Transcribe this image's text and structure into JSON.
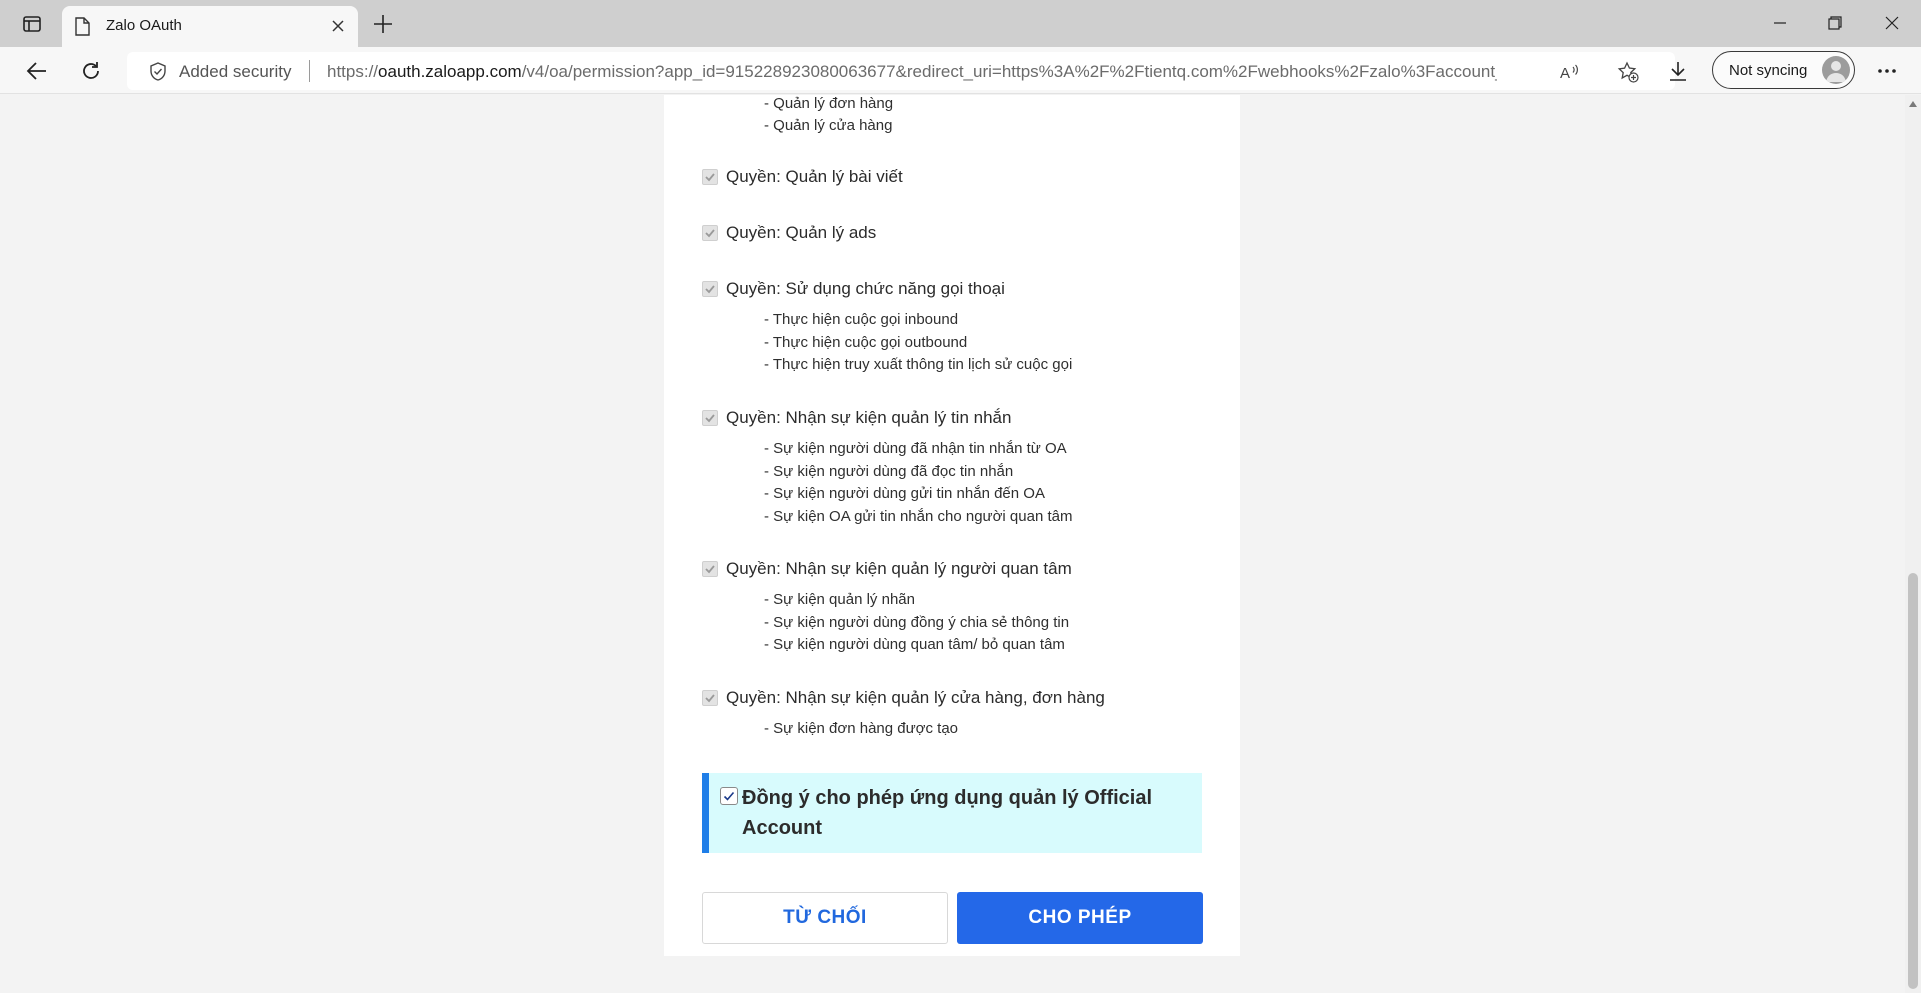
{
  "browser": {
    "tab_title": "Zalo OAuth",
    "security_label": "Added security",
    "url_prefix": "https://",
    "url_host": "oauth.zaloapp.com",
    "url_rest": "/v4/oa/permission?app_id=915228923080063677&redirect_uri=https%3A%2F%2Ftientq.com%2Fwebhooks%2Fzalo%3Faccount_i...",
    "sync_label": "Not syncing"
  },
  "permissions": {
    "top_partial": [
      "- Quản lý đơn hàng",
      "- Quản lý cửa hàng"
    ],
    "groups": [
      {
        "title": "Quyền: Quản lý bài viết",
        "items": []
      },
      {
        "title": "Quyền: Quản lý ads",
        "items": []
      },
      {
        "title": "Quyền: Sử dụng chức năng gọi thoại",
        "items": [
          "- Thực hiện cuộc gọi inbound",
          "- Thực hiện cuộc gọi outbound",
          "- Thực hiện truy xuất thông tin lịch sử cuộc gọi"
        ]
      },
      {
        "title": "Quyền: Nhận sự kiện quản lý tin nhắn",
        "items": [
          "- Sự kiện người dùng đã nhận tin nhắn từ OA",
          "- Sự kiện người dùng đã đọc tin nhắn",
          "- Sự kiện người dùng gửi tin nhắn đến OA",
          "- Sự kiện OA gửi tin nhắn cho người quan tâm"
        ]
      },
      {
        "title": "Quyền: Nhận sự kiện quản lý người quan tâm",
        "items": [
          "- Sự kiện quản lý nhãn",
          "- Sự kiện người dùng đồng ý chia sẻ thông tin",
          "- Sự kiện người dùng quan tâm/ bỏ quan tâm"
        ]
      },
      {
        "title": "Quyền: Nhận sự kiện quản lý cửa hàng, đơn hàng",
        "items": [
          "- Sự kiện đơn hàng được tạo"
        ]
      }
    ]
  },
  "consent": {
    "checked": true,
    "text": "Đồng ý cho phép ứng dụng quản lý Official Account"
  },
  "actions": {
    "deny_label": "TỪ CHỐI",
    "allow_label": "CHO PHÉP"
  },
  "colors": {
    "accent": "#2468e8",
    "consent_bg": "#d8fbfd",
    "consent_border": "#1f7ee8"
  }
}
